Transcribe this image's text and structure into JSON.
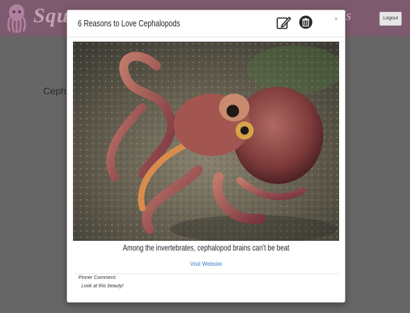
{
  "navbar": {
    "brand": "Squ",
    "right_text": "ards",
    "logout_label": "Logout"
  },
  "background": {
    "heading": "Cephalo"
  },
  "modal": {
    "title": "6 Reasons to Love Cephalopods",
    "edit_icon": "edit-pencil-icon",
    "delete_icon": "trash-icon",
    "close_label": "×",
    "caption": "Among the invertebrates, cephalopod brains can't be beat",
    "link_label": "Visit Website",
    "comment_label": "Pinner Comment:",
    "comment_text": "Look at this beauty!"
  },
  "colors": {
    "navbar": "#7d5a6e",
    "brand": "#c9a0b8",
    "overlay": "#666666",
    "link": "#2a7fd4"
  }
}
